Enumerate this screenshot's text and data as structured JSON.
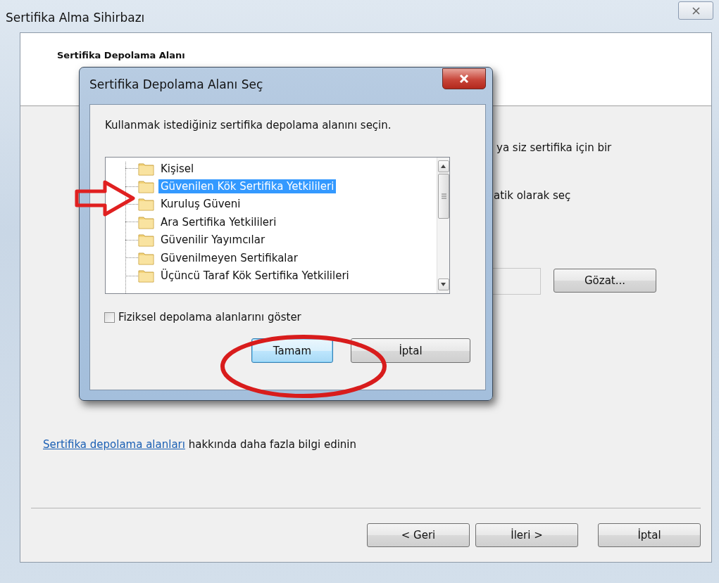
{
  "window": {
    "title": "Sertifika Alma Sihirbazı"
  },
  "header": {
    "title": "Sertifika Depolama Alanı"
  },
  "body": {
    "fragments": [
      "ya siz sertifika için bir",
      "atik olarak seç"
    ],
    "browse_button": "Gözat...",
    "info": {
      "link": "Sertifika depolama alanları",
      "text": " hakkında daha fazla bilgi edinin"
    }
  },
  "nav_buttons": [
    {
      "label": "< Geri"
    },
    {
      "label": "İleri >"
    },
    {
      "label": "İptal"
    }
  ],
  "dialog": {
    "title": "Sertifika Depolama Alanı Seç",
    "prompt": "Kullanmak istediğiniz sertifika depolama alanını seçin.",
    "stores": [
      {
        "name": "Kişisel",
        "selected": false
      },
      {
        "name": "Güvenilen Kök Sertifika Yetkilileri",
        "selected": true
      },
      {
        "name": "Kuruluş Güveni",
        "selected": false
      },
      {
        "name": "Ara Sertifika Yetkilileri",
        "selected": false
      },
      {
        "name": "Güvenilir Yayımcılar",
        "selected": false
      },
      {
        "name": "Güvenilmeyen Sertifikalar",
        "selected": false
      },
      {
        "name": "Üçüncü Taraf Kök Sertifika Yetkilileri",
        "selected": false
      }
    ],
    "show_physical": {
      "label": "Fiziksel depolama alanlarını göster",
      "checked": false
    },
    "buttons": [
      {
        "label": "Tamam",
        "default": true
      },
      {
        "label": "İptal",
        "default": false
      }
    ]
  }
}
